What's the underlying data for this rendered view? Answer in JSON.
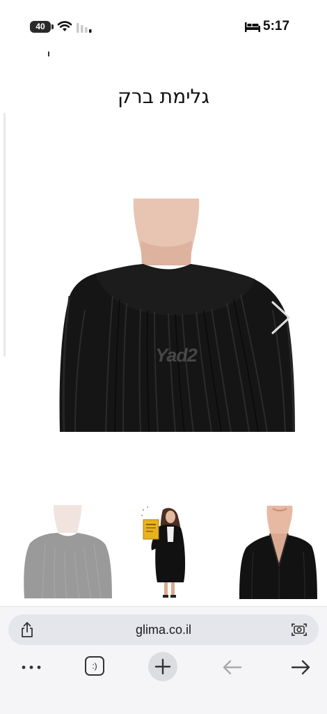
{
  "status_bar": {
    "battery": "40",
    "time": "5:17",
    "icons": [
      "battery-icon",
      "wifi-icon",
      "signal-icon",
      "bed-icon"
    ]
  },
  "product": {
    "title": "גלימת ברק",
    "main_image_watermark": "Yad2",
    "main_image": "black-graduation-gown-back-view",
    "next_image_icon": "chevron-right-icon",
    "thumbnails": [
      {
        "image": "gown-back-view-faded"
      },
      {
        "image": "woman-in-gown-holding-diploma"
      },
      {
        "image": "gown-front-view"
      }
    ]
  },
  "browser": {
    "url": "glima.co.il",
    "tab_count": ":)",
    "icons": [
      "share-icon",
      "visual-search-icon",
      "more-icon",
      "tabs-icon",
      "new-tab-icon",
      "back-arrow-icon",
      "forward-arrow-icon"
    ]
  },
  "colors": {
    "gown": "#161616",
    "mannequin": "#e9c7b6",
    "url_field": "#e4e6eb",
    "toolbar_bg": "#f5f5f7"
  }
}
